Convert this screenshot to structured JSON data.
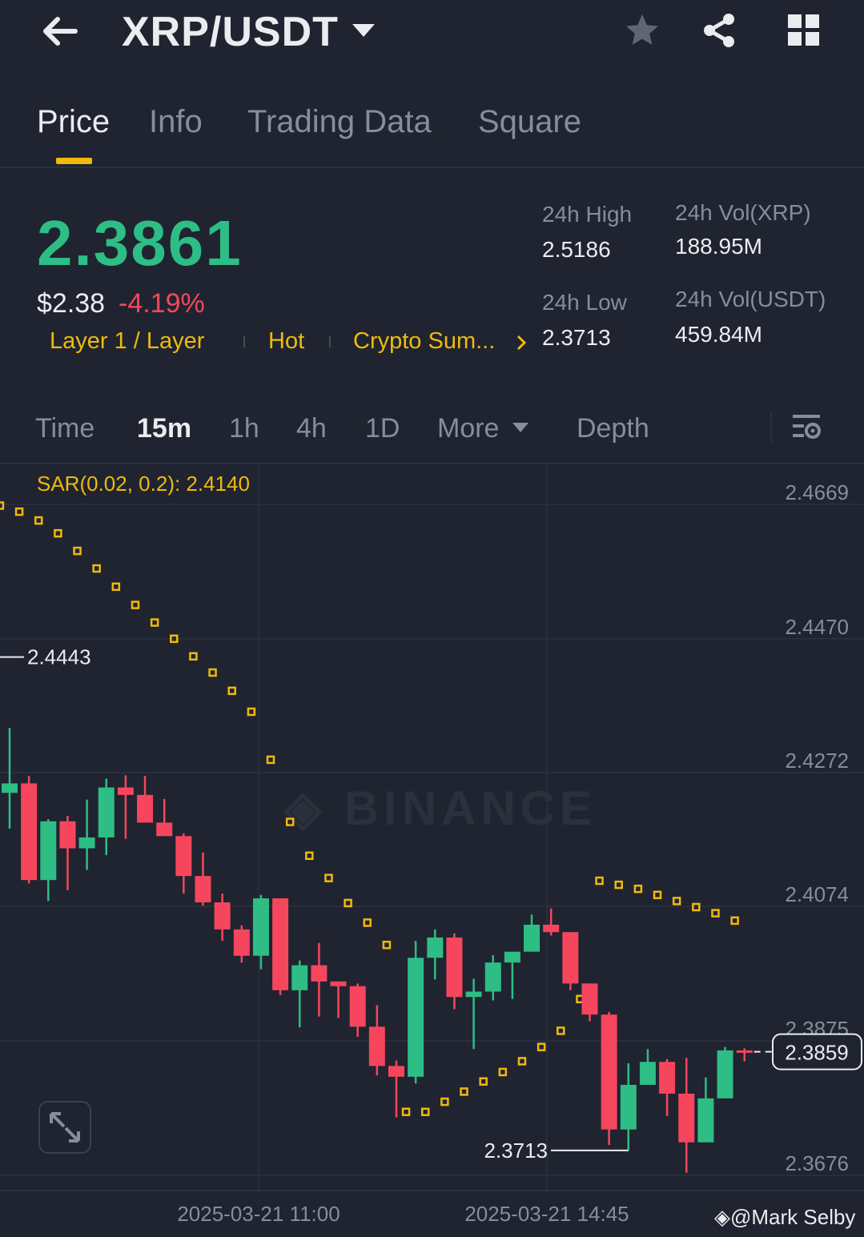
{
  "header": {
    "pair": "XRP/USDT",
    "icons": [
      "back-arrow-icon",
      "chevron-down-icon",
      "star-icon",
      "share-icon",
      "grid-icon"
    ]
  },
  "tabs": [
    {
      "label": "Price",
      "active": true
    },
    {
      "label": "Info"
    },
    {
      "label": "Trading Data"
    },
    {
      "label": "Square"
    }
  ],
  "ticker": {
    "last_price": "2.3861",
    "usd_price": "$2.38",
    "change": "-4.19%",
    "tags": [
      "Layer 1 / Layer",
      "Hot",
      "Crypto Sum..."
    ],
    "high_label": "24h High",
    "high": "2.5186",
    "low_label": "24h Low",
    "low": "2.3713",
    "vol_base_label": "24h Vol(XRP)",
    "vol_base": "188.95M",
    "vol_quote_label": "24h Vol(USDT)",
    "vol_quote": "459.84M"
  },
  "intervals": {
    "items": [
      "Time",
      "15m",
      "1h",
      "4h",
      "1D",
      "More",
      "Depth"
    ],
    "active": "15m"
  },
  "indicator": {
    "label": "SAR(0.02, 0.2): 2.4140"
  },
  "colors": {
    "up": "#2ebd85",
    "down": "#f6465d",
    "accent": "#f0b90b",
    "bg": "#1f2430"
  },
  "chart_data": {
    "type": "candlestick",
    "y_ticks": [
      2.4669,
      2.447,
      2.4272,
      2.4074,
      2.3875,
      2.3676
    ],
    "ylim": [
      2.3656,
      2.4728
    ],
    "x_labels": [
      "2025-03-21 11:00",
      "2025-03-21 14:45"
    ],
    "max_marker": "2.4443",
    "min_marker": "2.3713",
    "current_price": "2.3859",
    "candles": [
      {
        "o": 2.4242,
        "h": 2.4338,
        "l": 2.4189,
        "c": 2.4256
      },
      {
        "o": 2.4256,
        "h": 2.4267,
        "l": 2.4108,
        "c": 2.4113
      },
      {
        "o": 2.4113,
        "h": 2.4203,
        "l": 2.4082,
        "c": 2.42
      },
      {
        "o": 2.42,
        "h": 2.4208,
        "l": 2.4098,
        "c": 2.416
      },
      {
        "o": 2.416,
        "h": 2.4232,
        "l": 2.4128,
        "c": 2.4176
      },
      {
        "o": 2.4176,
        "h": 2.4263,
        "l": 2.415,
        "c": 2.425
      },
      {
        "o": 2.425,
        "h": 2.4268,
        "l": 2.4174,
        "c": 2.4239
      },
      {
        "o": 2.4239,
        "h": 2.4267,
        "l": 2.4199,
        "c": 2.4198
      },
      {
        "o": 2.4198,
        "h": 2.4233,
        "l": 2.418,
        "c": 2.4178
      },
      {
        "o": 2.4178,
        "h": 2.4182,
        "l": 2.4093,
        "c": 2.4119
      },
      {
        "o": 2.4119,
        "h": 2.4154,
        "l": 2.4075,
        "c": 2.408
      },
      {
        "o": 2.408,
        "h": 2.4093,
        "l": 2.4023,
        "c": 2.404
      },
      {
        "o": 2.404,
        "h": 2.4046,
        "l": 2.3991,
        "c": 2.4001
      },
      {
        "o": 2.4001,
        "h": 2.4091,
        "l": 2.3981,
        "c": 2.4086
      },
      {
        "o": 2.4086,
        "h": 2.4086,
        "l": 2.3943,
        "c": 2.395
      },
      {
        "o": 2.395,
        "h": 2.3994,
        "l": 2.3895,
        "c": 2.3987
      },
      {
        "o": 2.3987,
        "h": 2.402,
        "l": 2.3911,
        "c": 2.3963
      },
      {
        "o": 2.3963,
        "h": 2.3958,
        "l": 2.3909,
        "c": 2.3956
      },
      {
        "o": 2.3956,
        "h": 2.396,
        "l": 2.3881,
        "c": 2.3896
      },
      {
        "o": 2.3896,
        "h": 2.3928,
        "l": 2.3824,
        "c": 2.3838
      },
      {
        "o": 2.3838,
        "h": 2.3846,
        "l": 2.3762,
        "c": 2.3822
      },
      {
        "o": 2.3822,
        "h": 2.4023,
        "l": 2.3812,
        "c": 2.3998
      },
      {
        "o": 2.3998,
        "h": 2.404,
        "l": 2.3966,
        "c": 2.4028
      },
      {
        "o": 2.4028,
        "h": 2.4034,
        "l": 2.3922,
        "c": 2.394
      },
      {
        "o": 2.394,
        "h": 2.3967,
        "l": 2.3863,
        "c": 2.3948
      },
      {
        "o": 2.3948,
        "h": 2.4002,
        "l": 2.3935,
        "c": 2.3991
      },
      {
        "o": 2.3991,
        "h": 2.4001,
        "l": 2.3937,
        "c": 2.4007
      },
      {
        "o": 2.4007,
        "h": 2.4062,
        "l": 2.4008,
        "c": 2.4047
      },
      {
        "o": 2.4047,
        "h": 2.4071,
        "l": 2.4031,
        "c": 2.4036
      },
      {
        "o": 2.4036,
        "h": 2.4036,
        "l": 2.395,
        "c": 2.396
      },
      {
        "o": 2.396,
        "h": 2.396,
        "l": 2.3904,
        "c": 2.3914
      },
      {
        "o": 2.3914,
        "h": 2.3918,
        "l": 2.3721,
        "c": 2.3744
      },
      {
        "o": 2.3744,
        "h": 2.3842,
        "l": 2.3713,
        "c": 2.381
      },
      {
        "o": 2.381,
        "h": 2.3863,
        "l": 2.3823,
        "c": 2.3844
      },
      {
        "o": 2.3844,
        "h": 2.3848,
        "l": 2.3764,
        "c": 2.3797
      },
      {
        "o": 2.3797,
        "h": 2.385,
        "l": 2.368,
        "c": 2.3725
      },
      {
        "o": 2.3725,
        "h": 2.3821,
        "l": 2.3726,
        "c": 2.379
      },
      {
        "o": 2.379,
        "h": 2.3866,
        "l": 2.3798,
        "c": 2.3861
      },
      {
        "o": 2.3861,
        "h": 2.3864,
        "l": 2.3845,
        "c": 2.3859
      }
    ],
    "sar": [
      {
        "i": -0.5,
        "v": 2.4667
      },
      {
        "i": 0.5,
        "v": 2.4658
      },
      {
        "i": 1.5,
        "v": 2.4645
      },
      {
        "i": 2.5,
        "v": 2.4626
      },
      {
        "i": 3.5,
        "v": 2.46
      },
      {
        "i": 4.5,
        "v": 2.4574
      },
      {
        "i": 5.5,
        "v": 2.4547
      },
      {
        "i": 6.5,
        "v": 2.452
      },
      {
        "i": 7.5,
        "v": 2.4494
      },
      {
        "i": 8.5,
        "v": 2.447
      },
      {
        "i": 9.5,
        "v": 2.4444
      },
      {
        "i": 10.5,
        "v": 2.442
      },
      {
        "i": 11.5,
        "v": 2.4393
      },
      {
        "i": 12.5,
        "v": 2.4362
      },
      {
        "i": 13.5,
        "v": 2.4291
      },
      {
        "i": 14.5,
        "v": 2.4199
      },
      {
        "i": 15.5,
        "v": 2.4149
      },
      {
        "i": 16.5,
        "v": 2.4116
      },
      {
        "i": 17.5,
        "v": 2.4079
      },
      {
        "i": 18.5,
        "v": 2.405
      },
      {
        "i": 19.5,
        "v": 2.4017
      },
      {
        "i": 20.5,
        "v": 2.377
      },
      {
        "i": 21.5,
        "v": 2.377
      },
      {
        "i": 22.5,
        "v": 2.3785
      },
      {
        "i": 23.5,
        "v": 2.38
      },
      {
        "i": 24.5,
        "v": 2.3815
      },
      {
        "i": 25.5,
        "v": 2.3829
      },
      {
        "i": 26.5,
        "v": 2.3845
      },
      {
        "i": 27.5,
        "v": 2.3866
      },
      {
        "i": 28.5,
        "v": 2.389
      },
      {
        "i": 29.5,
        "v": 2.3937
      },
      {
        "i": 30.5,
        "v": 2.4112
      },
      {
        "i": 31.5,
        "v": 2.4106
      },
      {
        "i": 32.5,
        "v": 2.41
      },
      {
        "i": 33.5,
        "v": 2.4091
      },
      {
        "i": 34.5,
        "v": 2.4082
      },
      {
        "i": 35.5,
        "v": 2.4073
      },
      {
        "i": 36.5,
        "v": 2.4064
      },
      {
        "i": 37.5,
        "v": 2.4053
      }
    ]
  },
  "credit": "Mark Selby"
}
